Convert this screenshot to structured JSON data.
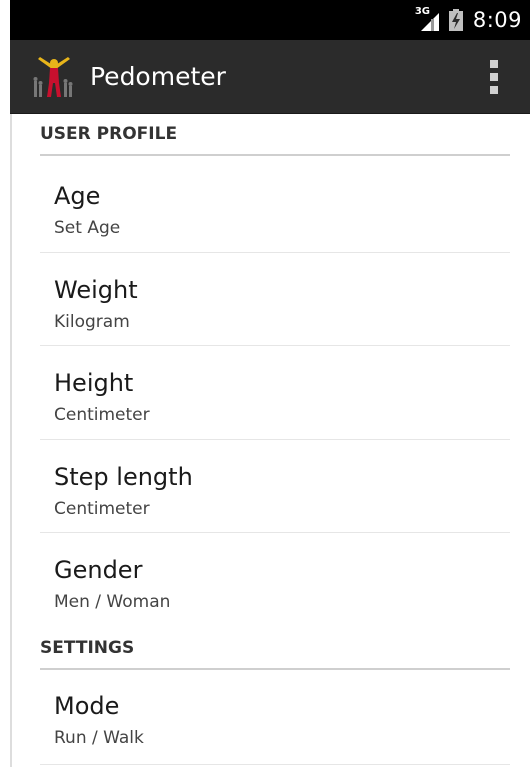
{
  "status_bar": {
    "network": "3G",
    "time": "8:09"
  },
  "action_bar": {
    "title": "Pedometer",
    "logo_icon": "runner-icon",
    "menu_icon": "overflow-menu-icon"
  },
  "sections": {
    "user_profile": {
      "header": "USER PROFILE",
      "items": [
        {
          "title": "Age",
          "summary": "Set Age"
        },
        {
          "title": "Weight",
          "summary": "Kilogram"
        },
        {
          "title": "Height",
          "summary": "Centimeter"
        },
        {
          "title": "Step length",
          "summary": "Centimeter"
        },
        {
          "title": "Gender",
          "summary": "Men / Woman"
        }
      ]
    },
    "settings": {
      "header": "SETTINGS",
      "items": [
        {
          "title": "Mode",
          "summary": "Run / Walk"
        }
      ]
    }
  },
  "colors": {
    "status_bar": "#000000",
    "action_bar": "#2b2b2b",
    "background": "#ffffff",
    "logo_accent": "#e8b51a",
    "logo_red": "#c8102e"
  }
}
